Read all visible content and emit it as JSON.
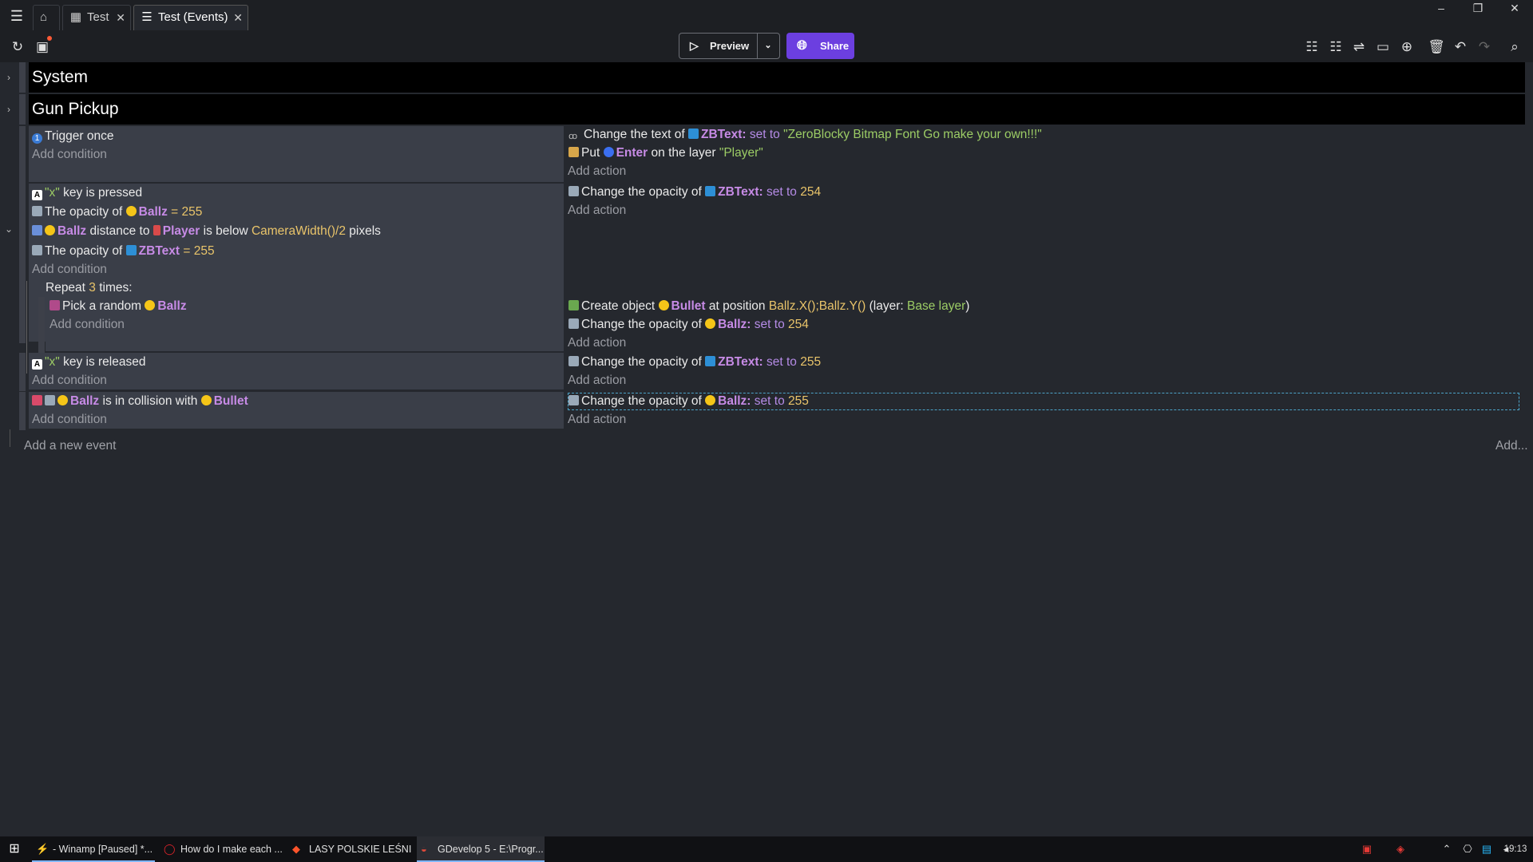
{
  "tabs": [
    {
      "label": "Test",
      "icon": "film-icon"
    },
    {
      "label": "Test (Events)",
      "icon": "events-icon"
    }
  ],
  "window_controls": {
    "minimize": "–",
    "restore": "❐",
    "close": "✕"
  },
  "toolbar": {
    "preview_label": "Preview",
    "share_label": "Share"
  },
  "groups": [
    {
      "label": "System"
    },
    {
      "label": "Gun Pickup"
    }
  ],
  "events": {
    "e1": {
      "cond1": "Trigger once",
      "add_condition": "Add condition",
      "act1_a": "Change the text of",
      "act1_obj": "ZBText",
      "act1_b": "set to",
      "act1_val": "\"ZeroBlocky Bitmap Font Go make your own!!!\"",
      "act2_a": "Put",
      "act2_obj": "Enter",
      "act2_b": "on the layer",
      "act2_val": "\"Player\"",
      "add_action": "Add action"
    },
    "e2": {
      "cond1_key": "\"x\"",
      "cond1_b": "key is pressed",
      "cond2_a": "The opacity of",
      "cond2_obj": "Ballz",
      "cond2_val": "= 255",
      "cond3_obj": "Ballz",
      "cond3_b": "distance to",
      "cond3_obj2": "Player",
      "cond3_c": "is below",
      "cond3_val": "CameraWidth()/2",
      "cond3_d": "pixels",
      "cond4_a": "The opacity of",
      "cond4_obj": "ZBText",
      "cond4_val": "= 255",
      "add_condition": "Add condition",
      "act1_a": "Change the opacity of",
      "act1_obj": "ZBText:",
      "act1_b": "set to",
      "act1_val": "254",
      "add_action": "Add action"
    },
    "repeat": {
      "label_a": "Repeat",
      "count": "3",
      "label_b": "times:",
      "cond1_a": "Pick a random",
      "cond1_obj": "Ballz",
      "add_condition": "Add condition",
      "act1_a": "Create object",
      "act1_obj": "Bullet",
      "act1_b": "at position",
      "act1_val": "Ballz.X();Ballz.Y()",
      "act1_c": "(layer:",
      "act1_layer": "Base layer",
      "act1_d": ")",
      "act2_a": "Change the opacity of",
      "act2_obj": "Ballz:",
      "act2_b": "set to",
      "act2_val": "254",
      "add_action": "Add action"
    },
    "e3": {
      "cond1_key": "\"x\"",
      "cond1_b": "key is released",
      "add_condition": "Add condition",
      "act1_a": "Change the opacity of",
      "act1_obj": "ZBText:",
      "act1_b": "set to",
      "act1_val": "255",
      "add_action": "Add action"
    },
    "e4": {
      "cond1_obj": "Ballz",
      "cond1_b": "is in collision with",
      "cond1_obj2": "Bullet",
      "add_condition": "Add condition",
      "act1_a": "Change the opacity of",
      "act1_obj": "Ballz:",
      "act1_b": "set to",
      "act1_val": "255",
      "add_action": "Add action"
    }
  },
  "add_event": "Add a new event",
  "add_more": "Add...",
  "taskbar": {
    "items": [
      {
        "label": "- Winamp [Paused] *...",
        "icon": "winamp-icon"
      },
      {
        "label": "How do I make each ...",
        "icon": "opera-icon"
      },
      {
        "label": "LASY POLSKIE LEŚNIC...",
        "icon": "brave-icon"
      },
      {
        "label": "GDevelop 5 - E:\\Progr...",
        "icon": "gdevelop-icon"
      }
    ],
    "clock": "19:13"
  }
}
